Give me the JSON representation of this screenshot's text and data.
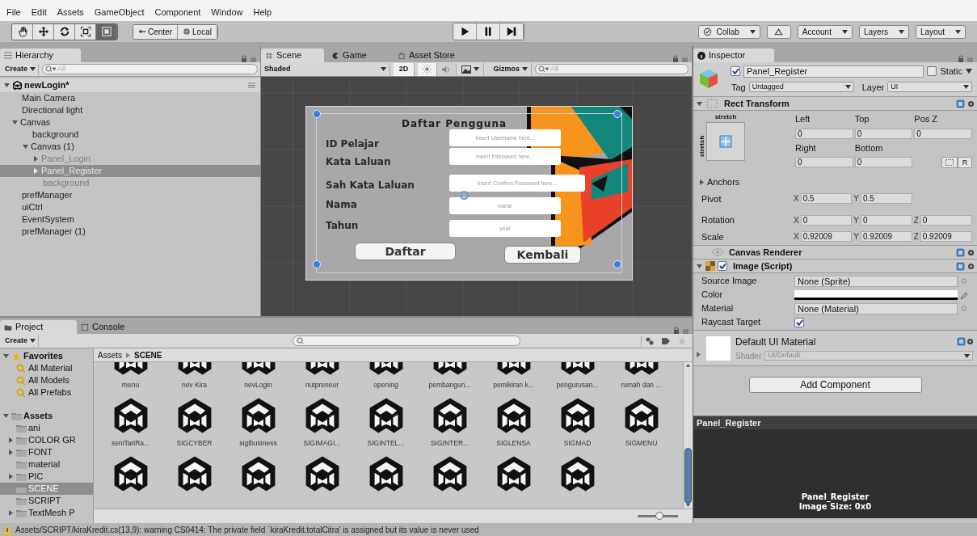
{
  "menu": [
    "File",
    "Edit",
    "Assets",
    "GameObject",
    "Component",
    "Window",
    "Help"
  ],
  "toolbar": {
    "tools": [
      {
        "selected": false
      },
      {
        "selected": false
      },
      {
        "selected": false
      },
      {
        "selected": false
      },
      {
        "selected": true
      }
    ],
    "pivot": [
      {
        "label": "Center"
      },
      {
        "label": "Local"
      }
    ],
    "right": [
      {
        "kind": "status-dropdown",
        "label": "Collab"
      },
      {
        "kind": "icon"
      },
      {
        "kind": "dropdown",
        "label": "Account"
      },
      {
        "kind": "dropdown",
        "label": "Layers"
      },
      {
        "kind": "dropdown",
        "label": "Layout"
      }
    ]
  },
  "hierarchy": {
    "title": "Hierarchy",
    "create": "Create",
    "search_placeholder": "All",
    "scene": "newLogin*",
    "scene_expanded": true,
    "items": [
      {
        "label": "Main Camera",
        "active": true,
        "selected": false
      },
      {
        "label": "Directional light",
        "active": true,
        "selected": false
      },
      {
        "label": "Canvas",
        "active": true,
        "selected": false,
        "expanded": true,
        "children": [
          {
            "label": "background",
            "active": true,
            "selected": false
          },
          {
            "label": "Canvas (1)",
            "active": true,
            "selected": false,
            "expanded": true,
            "children": [
              {
                "label": "Panel_Login",
                "active": false,
                "selected": false,
                "expanded": false
              },
              {
                "label": "Panel_Register",
                "active": false,
                "selected": true,
                "expanded": false
              },
              {
                "label": "background",
                "active": false,
                "selected": false
              }
            ]
          }
        ]
      },
      {
        "label": "prefManager",
        "active": true,
        "selected": false
      },
      {
        "label": "uiCtrl",
        "active": true,
        "selected": false
      },
      {
        "label": "EventSystem",
        "active": true,
        "selected": false
      },
      {
        "label": "prefManager (1)",
        "active": true,
        "selected": false
      }
    ]
  },
  "scene_view": {
    "tabs": [
      {
        "label": "Scene",
        "selected": true
      },
      {
        "label": "Game",
        "selected": false
      },
      {
        "label": "Asset Store",
        "selected": false
      }
    ],
    "shading": "Shaded",
    "mode_2d": {
      "label": "2D",
      "on": true
    },
    "lighting_on": true,
    "audio_on": false,
    "gizmos": "Gizmos",
    "search_placeholder": "All",
    "ui": {
      "title": "Daftar Pengguna",
      "fields": [
        {
          "label": "ID Pelajar",
          "placeholder": "Insert Username here..."
        },
        {
          "label": "Kata Laluan",
          "placeholder": "Insert Password here..."
        },
        {
          "label": "Sah Kata Laluan",
          "placeholder": "Insert Confirm Password here..."
        },
        {
          "label": "Nama",
          "placeholder": "name"
        },
        {
          "label": "Tahun",
          "placeholder": "year"
        }
      ],
      "buttons": [
        "Daftar",
        "Kembali"
      ]
    }
  },
  "inspector": {
    "title": "Inspector",
    "object": {
      "enabled": true,
      "name": "Panel_Register",
      "static": false,
      "static_label": "Static",
      "tag_label": "Tag",
      "tag": "Untagged",
      "layer_label": "Layer",
      "layer": "UI"
    },
    "rect_transform": {
      "title": "Rect Transform",
      "expanded": true,
      "anchor_h": "stretch",
      "anchor_v": "stretch",
      "fields": [
        {
          "label": "Left",
          "value": "0"
        },
        {
          "label": "Top",
          "value": "0"
        },
        {
          "label": "Pos Z",
          "value": "0"
        },
        {
          "label": "Right",
          "value": "0"
        },
        {
          "label": "Bottom",
          "value": "0"
        }
      ],
      "raw_button": "R",
      "anchors": "Anchors",
      "anchors_expanded": false,
      "vectors": [
        {
          "label": "Pivot",
          "values": [
            {
              "axis": "X",
              "value": "0.5"
            },
            {
              "axis": "Y",
              "value": "0.5"
            }
          ]
        },
        {
          "label": "Rotation",
          "values": [
            {
              "axis": "X",
              "value": "0"
            },
            {
              "axis": "Y",
              "value": "0"
            },
            {
              "axis": "Z",
              "value": "0"
            }
          ]
        },
        {
          "label": "Scale",
          "values": [
            {
              "axis": "X",
              "value": "0.92009"
            },
            {
              "axis": "Y",
              "value": "0.92009"
            },
            {
              "axis": "Z",
              "value": "0.92009"
            }
          ]
        }
      ]
    },
    "canvas_renderer": {
      "title": "Canvas Renderer"
    },
    "image": {
      "title": "Image (Script)",
      "enabled": true,
      "expanded": true,
      "props": [
        {
          "kind": "object",
          "label": "Source Image",
          "value": "None (Sprite)"
        },
        {
          "kind": "color",
          "label": "Color",
          "color": "#ffffff"
        },
        {
          "kind": "object",
          "label": "Material",
          "value": "None (Material)"
        },
        {
          "kind": "checkbox",
          "label": "Raycast Target",
          "checked": true
        }
      ]
    },
    "material": {
      "name": "Default UI Material",
      "shader_label": "Shader",
      "shader": "UI/Default"
    },
    "add_component": "Add Component",
    "preview": {
      "title": "Panel_Register",
      "name": "Panel_Register",
      "size": "Image Size: 0x0"
    }
  },
  "project": {
    "tabs": [
      {
        "label": "Project",
        "selected": true
      },
      {
        "label": "Console",
        "selected": false
      }
    ],
    "create": "Create",
    "favorites": {
      "label": "Favorites",
      "expanded": true,
      "items": [
        "All Material",
        "All Models",
        "All Prefabs"
      ]
    },
    "assets": {
      "label": "Assets",
      "expanded": true,
      "children": [
        {
          "label": "ani",
          "selected": false
        },
        {
          "label": "COLOR GR",
          "selected": false,
          "expanded": false
        },
        {
          "label": "FONT",
          "selected": false,
          "expanded": false
        },
        {
          "label": "material",
          "selected": false
        },
        {
          "label": "PIC",
          "selected": false,
          "expanded": false
        },
        {
          "label": "SCENE",
          "selected": true
        },
        {
          "label": "SCRIPT",
          "selected": false
        },
        {
          "label": "TextMesh P",
          "selected": false,
          "expanded": false
        }
      ]
    },
    "breadcrumb": [
      "Assets",
      "SCENE"
    ],
    "grid": [
      {
        "kind": "cut-top",
        "items": [
          {
            "name": "menu",
            "selected": false
          },
          {
            "name": "nev Kira",
            "selected": false
          },
          {
            "name": "nevLogin",
            "selected": false
          },
          {
            "name": "nutpreneur",
            "selected": false
          },
          {
            "name": "opening",
            "selected": false
          },
          {
            "name": "pembangun...",
            "selected": false
          },
          {
            "name": "pemikiran k...",
            "selected": false
          },
          {
            "name": "pengurusan...",
            "selected": false
          },
          {
            "name": "rumah dan ...",
            "selected": false
          }
        ]
      },
      {
        "kind": "full",
        "items": [
          {
            "name": "seniTariRa...",
            "selected": false
          },
          {
            "name": "SIGCYBER",
            "selected": false
          },
          {
            "name": "sigibusiness",
            "selected": false
          },
          {
            "name": "SIGIMAGI...",
            "selected": false
          },
          {
            "name": "SIGINTEL...",
            "selected": false
          },
          {
            "name": "SIGINTER...",
            "selected": false
          },
          {
            "name": "SIGLENSA",
            "selected": false
          },
          {
            "name": "SIGMAD",
            "selected": false
          },
          {
            "name": "SIGMENU",
            "selected": false
          }
        ]
      },
      {
        "kind": "cut-bottom",
        "items": [
          {
            "selected": false
          },
          {
            "selected": false
          },
          {
            "selected": false
          },
          {
            "selected": false
          },
          {
            "selected": false
          },
          {
            "selected": false
          },
          {
            "selected": false
          },
          {
            "selected": false
          }
        ]
      }
    ],
    "icon_size": {
      "level": 0.55
    }
  },
  "status_bar": {
    "kind": "warning",
    "text": "Assets/SCRIPT/kiraKredit.cs(13,9): warning CS0414: The private field `kiraKredit.totalCitra' is assigned but its value is never used"
  }
}
